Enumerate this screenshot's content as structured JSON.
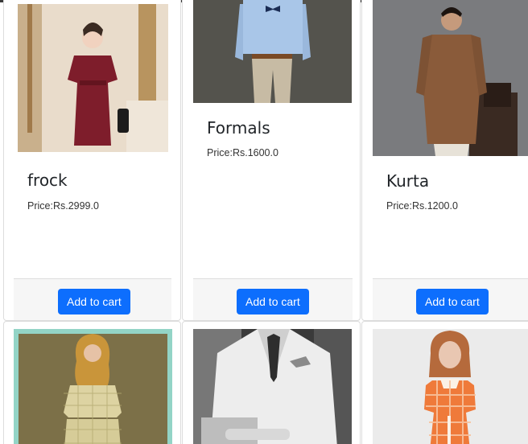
{
  "products": [
    {
      "name": "frock",
      "price": "Price:Rs.2999.0",
      "button": "Add to cart",
      "image_alt": "woman in red frock"
    },
    {
      "name": "Formals",
      "price": "Price:Rs.1600.0",
      "button": "Add to cart",
      "image_alt": "man in formal shirt and bow tie"
    },
    {
      "name": "Kurta",
      "price": "Price:Rs.1200.0",
      "button": "Add to cart",
      "image_alt": "man in brown kurta"
    },
    {
      "name": "",
      "price": "",
      "button": "",
      "image_alt": "woman in plaid co-ord set"
    },
    {
      "name": "",
      "price": "",
      "button": "",
      "image_alt": "man in white double-breasted suit"
    },
    {
      "name": "",
      "price": "",
      "button": "",
      "image_alt": "person in orange gingham dress"
    }
  ],
  "colors": {
    "button": "#0d6efd",
    "footer": "#f6f6f6",
    "border": "#dcdcdc"
  }
}
